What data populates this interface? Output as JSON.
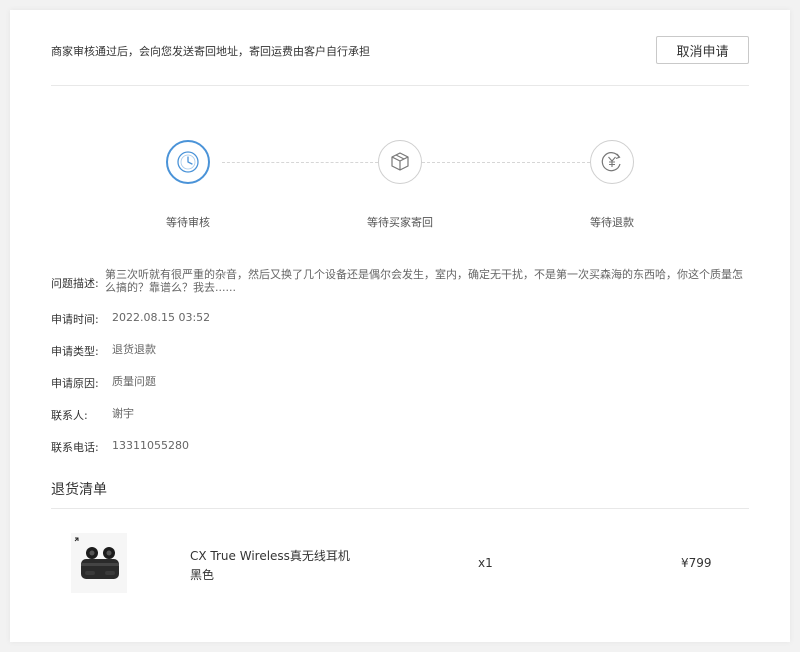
{
  "header": {
    "notice": "商家审核通过后，会向您发送寄回地址，寄回运费由客户自行承担",
    "cancel_label": "取消申请"
  },
  "steps": [
    {
      "label": "等待审核",
      "icon": "clock-icon",
      "active": true
    },
    {
      "label": "等待买家寄回",
      "icon": "package-icon",
      "active": false
    },
    {
      "label": "等待退款",
      "icon": "yuan-refund-icon",
      "active": false
    }
  ],
  "info": {
    "description_label": "问题描述:",
    "description": "第三次听就有很严重的杂音，然后又换了几个设备还是偶尔会发生，室内，确定无干扰，不是第一次买森海的东西哈，你这个质量怎么搞的？靠谱么？我去......",
    "time_label": "申请时间:",
    "time": "2022.08.15 03:52",
    "type_label": "申请类型:",
    "type": "退货退款",
    "reason_label": "申请原因:",
    "reason": "质量问题",
    "contact_label": "联系人:",
    "contact": "谢宇",
    "phone_label": "联系电话:",
    "phone": "13311055280"
  },
  "return_list": {
    "title": "退货清单",
    "item": {
      "name": "CX True Wireless真无线耳机",
      "color": "黑色",
      "qty": "x1",
      "price": "¥799"
    }
  },
  "colors": {
    "accent": "#4a93d8",
    "border": "#cfcfcf"
  }
}
